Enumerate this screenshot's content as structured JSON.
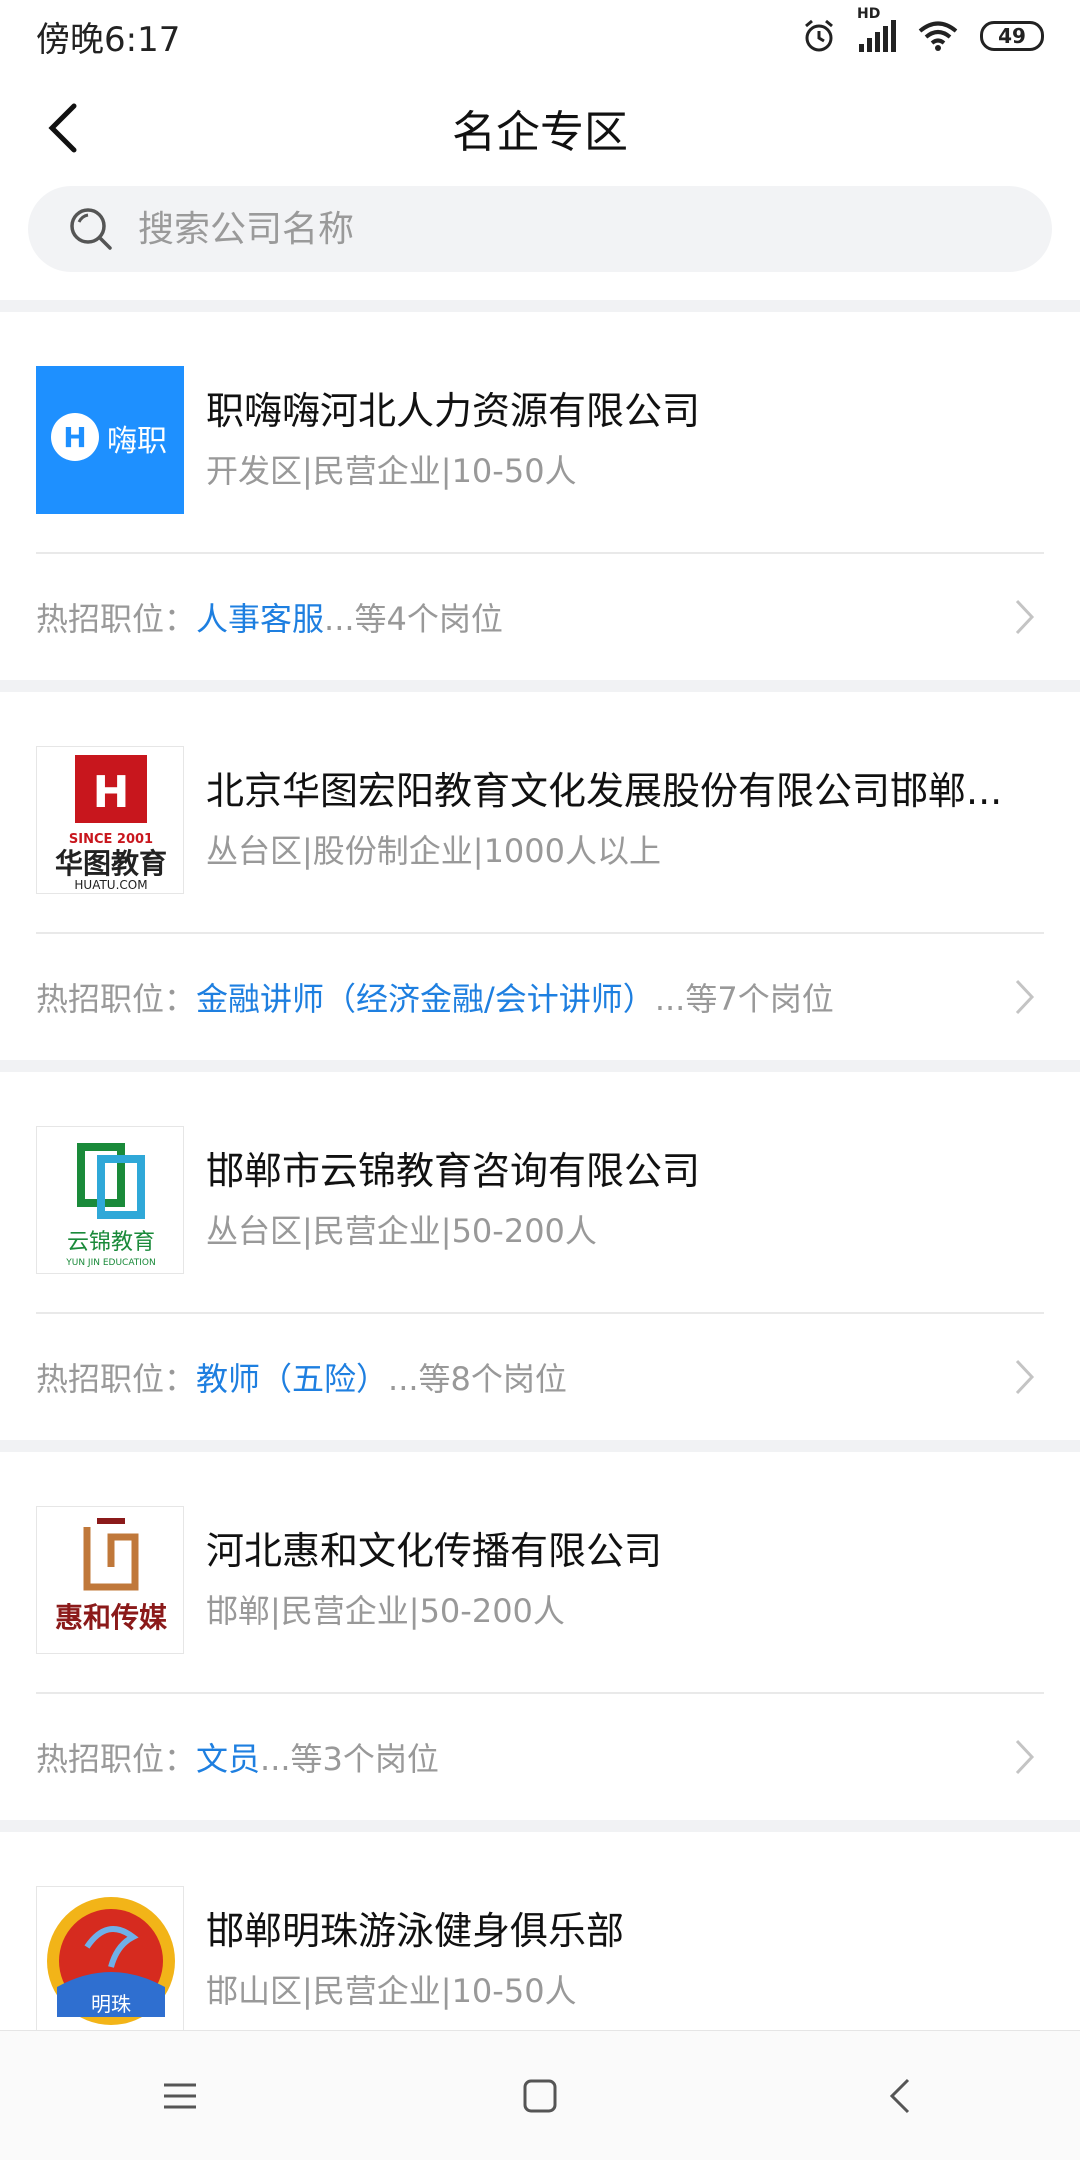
{
  "status": {
    "time": "傍晚6:17",
    "battery": "49",
    "hd_label": "HD"
  },
  "header": {
    "title": "名企专区"
  },
  "search": {
    "placeholder": "搜索公司名称"
  },
  "companies": [
    {
      "name": "职嗨嗨河北人力资源有限公司",
      "meta": "开发区|民营企业|10-50人",
      "hot_prefix": "热招职位：",
      "hot_job": "人事客服",
      "hot_suffix": "...等4个岗位",
      "logo_text": "嗨职",
      "logo_color": "#1e90ff"
    },
    {
      "name": "北京华图宏阳教育文化发展股份有限公司邯郸...",
      "meta": "丛台区|股份制企业|1000人以上",
      "hot_prefix": "热招职位：",
      "hot_job": "金融讲师（经济金融/会计讲师）",
      "hot_suffix": "...等7个岗位",
      "logo_text": "华图教育",
      "logo_sub": "SINCE 2001",
      "logo_sub2": "HUATU.COM",
      "logo_color": "#c8161d"
    },
    {
      "name": "邯郸市云锦教育咨询有限公司",
      "meta": "丛台区|民营企业|50-200人",
      "hot_prefix": "热招职位：",
      "hot_job": "教师（五险）",
      "hot_suffix": "...等8个岗位",
      "logo_text": "云锦教育",
      "logo_sub": "YUN JIN EDUCATION",
      "logo_color": "#1a8a3a"
    },
    {
      "name": "河北惠和文化传播有限公司",
      "meta": "邯郸|民营企业|50-200人",
      "hot_prefix": "热招职位：",
      "hot_job": "文员",
      "hot_suffix": "...等3个岗位",
      "logo_text": "惠和传媒",
      "logo_color": "#8b1a1a"
    },
    {
      "name": "邯郸明珠游泳健身俱乐部",
      "meta": "邯山区|民营企业|10-50人",
      "logo_text": "明珠",
      "logo_color": "#d62b1f"
    }
  ],
  "colors": {
    "accent": "#1e7fe0",
    "muted": "#999999",
    "band": "#f1f2f4"
  }
}
